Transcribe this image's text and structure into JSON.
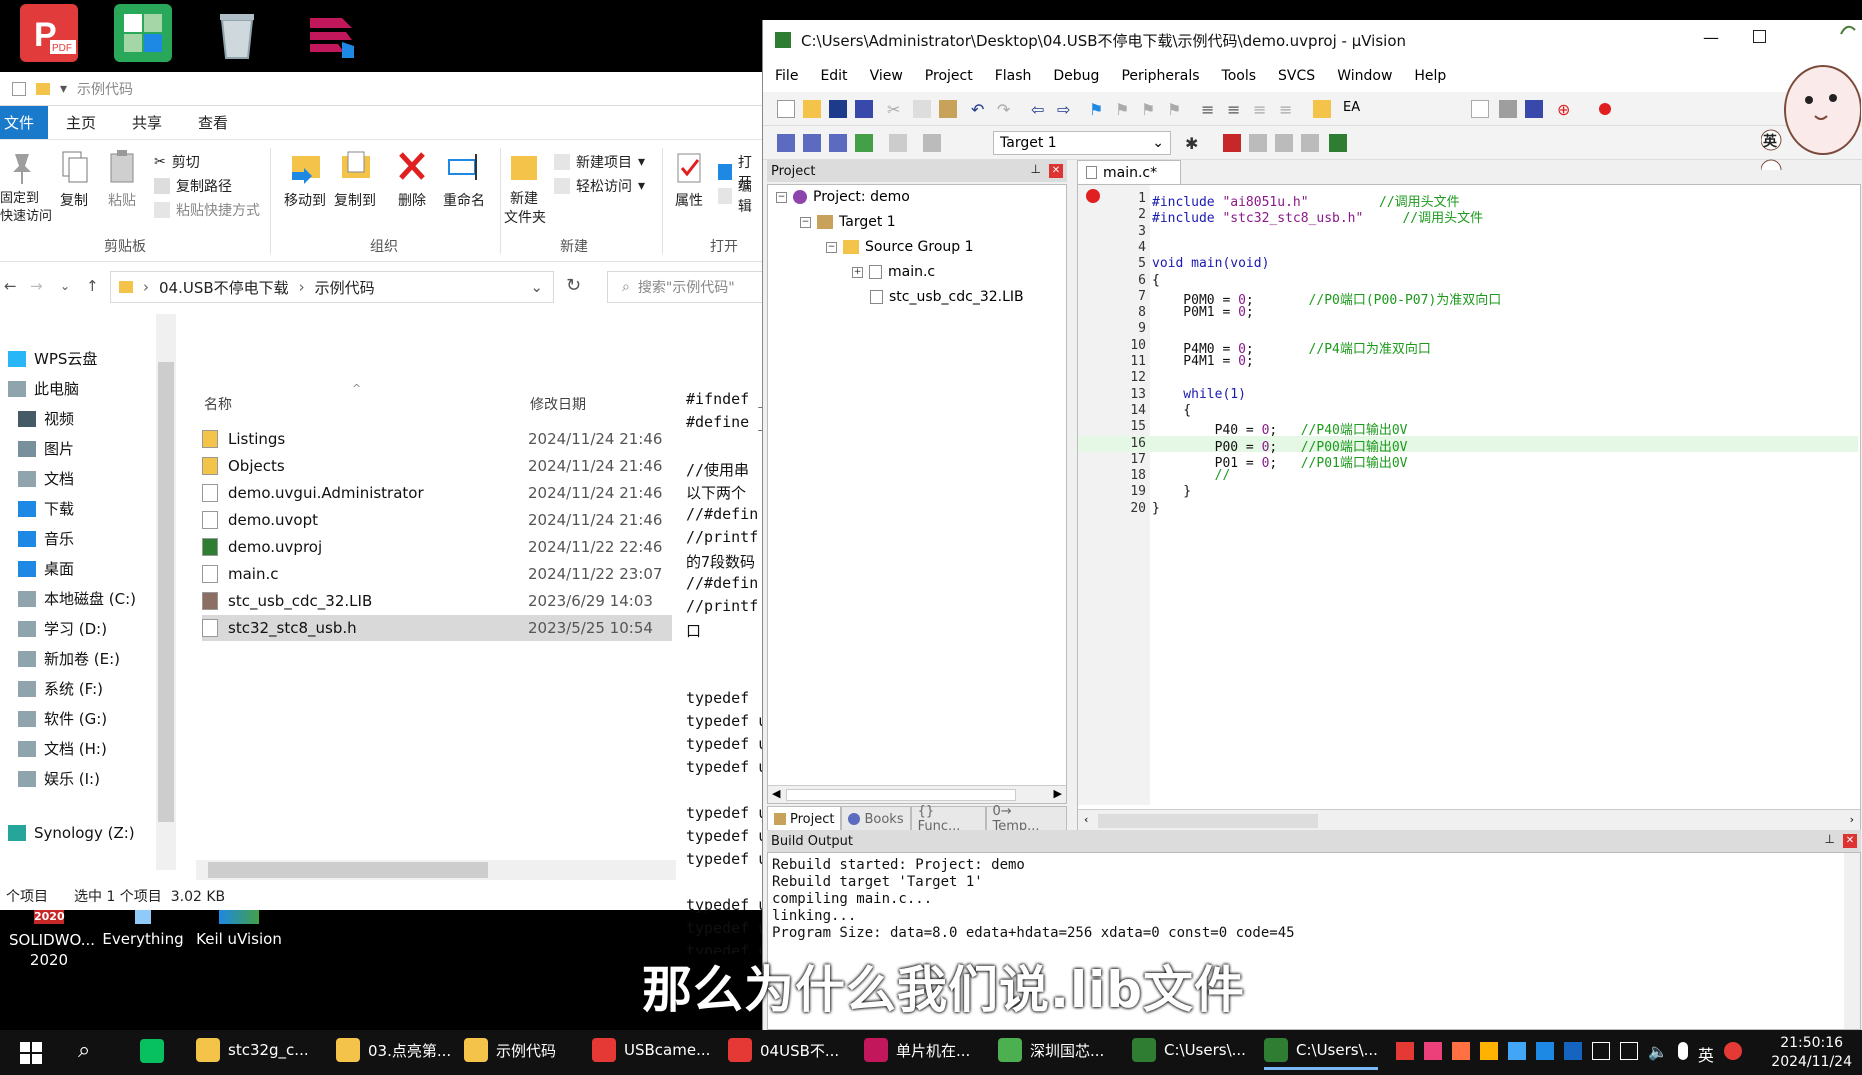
{
  "desktop": {
    "icons": [
      {
        "name": "wps-pdf-icon",
        "label": "",
        "color": "#e23b3b"
      },
      {
        "name": "wps-office-icon",
        "label": "",
        "color": "#2aa85a"
      },
      {
        "name": "recycle-bin-icon",
        "label": "",
        "color": "#cfd8dc"
      },
      {
        "name": "app-shortcut-icon",
        "label": "",
        "color": "#c2185b"
      }
    ],
    "bottom_icons": [
      {
        "label": "SOLIDWO... 2020",
        "badge": "2020"
      },
      {
        "label": "Everything"
      },
      {
        "label": "Keil uVision"
      }
    ]
  },
  "explorer": {
    "title": "示例代码",
    "tabs": [
      "文件",
      "主页",
      "共享",
      "查看"
    ],
    "ribbon": {
      "pin": "固定到\n快速访问",
      "copy": "复制",
      "paste": "粘贴",
      "cut": "剪切",
      "copy_path": "复制路径",
      "paste_shortcut": "粘贴快捷方式",
      "move_to": "移动到",
      "copy_to": "复制到",
      "delete": "删除",
      "rename": "重命名",
      "new_folder": "新建\n文件夹",
      "new_item": "新建项目",
      "easy_access": "轻松访问",
      "properties": "属性",
      "open": "打开",
      "edit": "编辑",
      "groups": [
        "剪贴板",
        "组织",
        "新建",
        "打开"
      ]
    },
    "address": {
      "crumbs": [
        "04.USB不停电下载",
        "示例代码"
      ],
      "search_placeholder": "搜索\"示例代码\""
    },
    "nav": [
      "WPS云盘",
      "此电脑",
      "视频",
      "图片",
      "文档",
      "下载",
      "音乐",
      "桌面",
      "本地磁盘 (C:)",
      "学习 (D:)",
      "新加卷 (E:)",
      "系统 (F:)",
      "软件 (G:)",
      "文档 (H:)",
      "娱乐 (I:)",
      "Synology (Z:)"
    ],
    "columns": {
      "name": "名称",
      "date": "修改日期"
    },
    "files": [
      {
        "name": "Listings",
        "date": "2024/11/24 21:46",
        "type": "folder"
      },
      {
        "name": "Objects",
        "date": "2024/11/24 21:46",
        "type": "folder"
      },
      {
        "name": "demo.uvgui.Administrator",
        "date": "2024/11/24 21:46",
        "type": "file"
      },
      {
        "name": "demo.uvopt",
        "date": "2024/11/24 21:46",
        "type": "file"
      },
      {
        "name": "demo.uvproj",
        "date": "2024/11/22 22:46",
        "type": "uvproj"
      },
      {
        "name": "main.c",
        "date": "2024/11/22 23:07",
        "type": "c"
      },
      {
        "name": "stc_usb_cdc_32.LIB",
        "date": "2023/6/29 14:03",
        "type": "lib"
      },
      {
        "name": "stc32_stc8_usb.h",
        "date": "2023/5/25 10:54",
        "type": "c",
        "selected": true
      }
    ],
    "preview_lines": [
      "#ifndef _",
      "#define _",
      "",
      "//使用串",
      "以下两个",
      "//#defin",
      "//printf",
      "的7段数码",
      "//#defin",
      "//printf",
      "口",
      "",
      "",
      "typedef ",
      "typedef u",
      "typedef u",
      "typedef u",
      "",
      "typedef u",
      "typedef u",
      "typedef u",
      "",
      "typedef u",
      "typedef u",
      "typedef u",
      "typedef "
    ],
    "status": {
      "count": "个项目",
      "selected": "选中 1 个项目  3.02 KB"
    }
  },
  "uvision": {
    "title": "C:\\Users\\Administrator\\Desktop\\04.USB不停电下载\\示例代码\\demo.uvproj - µVision",
    "menu": [
      "File",
      "Edit",
      "View",
      "Project",
      "Flash",
      "Debug",
      "Peripherals",
      "Tools",
      "SVCS",
      "Window",
      "Help"
    ],
    "toolbar_label": "EA",
    "target": "Target 1",
    "project_panel": {
      "title": "Project",
      "tree": [
        "Project: demo",
        "Target 1",
        "Source Group 1",
        "main.c",
        "stc_usb_cdc_32.LIB"
      ],
      "tabs": [
        "Project",
        "Books",
        "{} Func...",
        "0→ Temp..."
      ]
    },
    "editor": {
      "tab": "main.c*",
      "lines": [
        {
          "n": "1",
          "code": "#include ",
          "str": "\"ai8051u.h\"",
          "cm": "         //调用头文件"
        },
        {
          "n": "2",
          "code": "#include ",
          "str": "\"stc32_stc8_usb.h\"",
          "cm": "     //调用头文件"
        },
        {
          "n": "3",
          "code": ""
        },
        {
          "n": "4",
          "code": ""
        },
        {
          "n": "5",
          "code": "void main(void)"
        },
        {
          "n": "6",
          "code": "{"
        },
        {
          "n": "7",
          "code": "    P0M0 = ",
          "num": "0",
          "rest": ";",
          "cm": "       //P0端口(P00-P07)为准双向口"
        },
        {
          "n": "8",
          "code": "    P0M1 = ",
          "num": "0",
          "rest": ";"
        },
        {
          "n": "9",
          "code": ""
        },
        {
          "n": "10",
          "code": "    P4M0 = ",
          "num": "0",
          "rest": ";",
          "cm": "       //P4端口为准双向口"
        },
        {
          "n": "11",
          "code": "    P4M1 = ",
          "num": "0",
          "rest": ";"
        },
        {
          "n": "12",
          "code": ""
        },
        {
          "n": "13",
          "code": "    while(1)"
        },
        {
          "n": "14",
          "code": "    {"
        },
        {
          "n": "15",
          "code": "        P40 = ",
          "num": "0",
          "rest": ";",
          "cm": "   //P40端口输出0V"
        },
        {
          "n": "16",
          "code": "        P00 = ",
          "num": "0",
          "rest": ";",
          "cm": "   //P00端口输出0V",
          "hl": true
        },
        {
          "n": "17",
          "code": "        P01 = ",
          "num": "0",
          "rest": ";",
          "cm": "   //P01端口输出0V"
        },
        {
          "n": "18",
          "code": "        ",
          "cm": "//"
        },
        {
          "n": "19",
          "code": "    }"
        },
        {
          "n": "20",
          "code": "}"
        }
      ]
    },
    "build_output": {
      "title": "Build Output",
      "lines": [
        "Rebuild started: Project: demo",
        "Rebuild target 'Target 1'",
        "compiling main.c...",
        "linking...",
        "Program Size: data=8.0 edata+hdata=256 xdata=0 const=0 code=45"
      ]
    }
  },
  "subtitle": "那么为什么我们说.lib文件",
  "taskbar": {
    "items": [
      {
        "label": "stc32g_c...",
        "color": "#f3c34a"
      },
      {
        "label": "03.点亮第...",
        "color": "#f3c34a"
      },
      {
        "label": "示例代码",
        "color": "#f3c34a"
      },
      {
        "label": "USBcame...",
        "color": "#e53935"
      },
      {
        "label": "04USB不...",
        "color": "#e53935"
      },
      {
        "label": "单片机在...",
        "color": "#c2185b"
      },
      {
        "label": "深圳国芯...",
        "color": "#4caf50"
      },
      {
        "label": "C:\\Users\\...",
        "color": "#2e7d32"
      },
      {
        "label": "C:\\Users\\...",
        "color": "#2e7d32"
      }
    ],
    "ime": "英",
    "time": "21:50:16",
    "date": "2024/11/24"
  }
}
